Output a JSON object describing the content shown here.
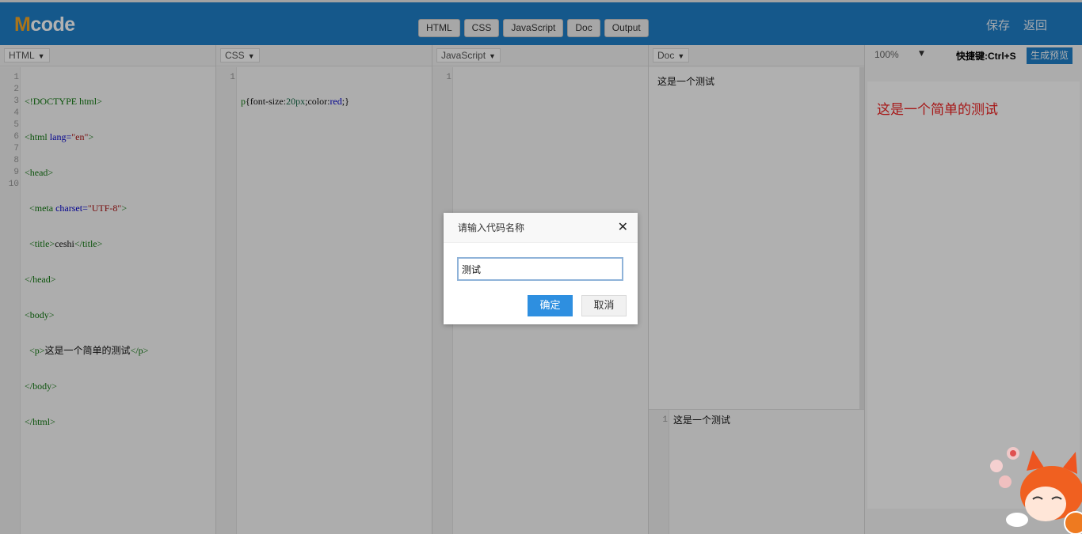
{
  "header": {
    "logo_m": "M",
    "logo_rest": "code",
    "tabs": [
      "HTML",
      "CSS",
      "JavaScript",
      "Doc",
      "Output"
    ],
    "save": "保存",
    "back": "返回"
  },
  "panes": {
    "html": {
      "dropdown": "HTML"
    },
    "css": {
      "dropdown": "CSS",
      "line_numbers": [
        "1"
      ]
    },
    "js": {
      "dropdown": "JavaScript",
      "line_numbers": [
        "1"
      ]
    },
    "doc": {
      "dropdown": "Doc",
      "text": "这是一个测试",
      "bottom_line": "1",
      "bottom_text": "这是一个测试"
    },
    "output": {
      "zoom": "100%",
      "shortcut": "快捷键:Ctrl+S",
      "generate_label": "生成预览",
      "preview_text": "这是一个简单的测试"
    }
  },
  "html_lines": [
    "1",
    "2",
    "3",
    "4",
    "5",
    "6",
    "7",
    "8",
    "9",
    "10"
  ],
  "html_code": {
    "l1": "<!DOCTYPE html>",
    "l2a": "<html ",
    "l2b": "lang=",
    "l2c": "\"en\"",
    "l2d": ">",
    "l3": "<head>",
    "l4a": "  <meta ",
    "l4b": "charset=",
    "l4c": "\"UTF-8\"",
    "l4d": ">",
    "l5a": "  <title>",
    "l5b": "ceshi",
    "l5c": "</title>",
    "l6": "</head>",
    "l7": "<body>",
    "l8a": "  <p>",
    "l8b": "这是一个简单的测试",
    "l8c": "</p>",
    "l9": "</body>",
    "l10": "</html>"
  },
  "css_code": {
    "sel": "p",
    "open": "{",
    "p1": "font-size:",
    "v1": "20px",
    "semi": ";",
    "p2": "color:",
    "v2": "red",
    "semi2": ";",
    "close": "}"
  },
  "dialog": {
    "title": "请输入代码名称",
    "close": "✕",
    "input_value": "测试",
    "ok": "确定",
    "cancel": "取消"
  },
  "colors": {
    "brand": "#1f7ec8",
    "logo_accent": "#f5a623",
    "preview_red": "#ee2222",
    "ok_button": "#2e8fe0"
  }
}
